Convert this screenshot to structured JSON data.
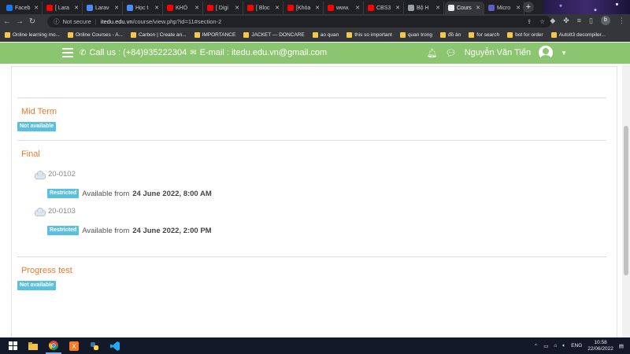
{
  "browser": {
    "tabs": [
      {
        "label": "Faceb",
        "color": "#1877f2",
        "active": false
      },
      {
        "label": "[ Lara",
        "color": "#ff0000",
        "active": false
      },
      {
        "label": "Larav",
        "color": "#4a8cff",
        "active": false
      },
      {
        "label": "Học t",
        "color": "#4a8cff",
        "active": false
      },
      {
        "label": "KHÓ",
        "color": "#ff0000",
        "active": false
      },
      {
        "label": "[ Digi",
        "color": "#ff0000",
        "active": false
      },
      {
        "label": "[ Bloc",
        "color": "#ff0000",
        "active": false
      },
      {
        "label": "[Khóa",
        "color": "#ff0000",
        "active": false
      },
      {
        "label": "www.",
        "color": "#ff0000",
        "active": false
      },
      {
        "label": "CBS3",
        "color": "#ff0000",
        "active": false
      },
      {
        "label": "Bộ H",
        "color": "#9aa0a6",
        "active": false
      },
      {
        "label": "Cours",
        "color": "#e8eaed",
        "active": true
      },
      {
        "label": "Micro",
        "color": "#5b5fc7",
        "active": false
      }
    ],
    "new_tab": "+",
    "address": {
      "warning": "Not secure",
      "domain": "itedu.edu.vn",
      "path": "/course/view.php?id=11#section-2"
    },
    "profile_initial": "b",
    "bookmarks": [
      "Online learning mo...",
      "Online Courses - A...",
      "Carbon | Create an...",
      "IMPORTANCE",
      "JACKET — DONCARE",
      "ao quan",
      "this so important",
      "quan trong",
      "đồ án",
      "for search",
      "bot for order",
      "AutoIt3 decompiler..."
    ]
  },
  "header": {
    "phone_label": "Call us : (+84)935222304",
    "email_label": "E-mail : itedu.edu.vn@gmail.com",
    "user_name": "Nguyễn Văn Tiến"
  },
  "sections": {
    "mid_term": {
      "title": "Mid Term",
      "badge": "Not available"
    },
    "final": {
      "title": "Final",
      "activities": [
        {
          "name": "20-0102",
          "badge": "Restricted",
          "text": "Available from",
          "date": "24 June 2022, 8:00 AM"
        },
        {
          "name": "20-0103",
          "badge": "Restricted",
          "text": "Available from",
          "date": "24 June 2022, 2:00 PM"
        }
      ]
    },
    "progress_test": {
      "title": "Progress test",
      "badge": "Not available"
    }
  },
  "taskbar": {
    "language": "ENG",
    "time": "10:58",
    "date": "22/06/2022"
  }
}
